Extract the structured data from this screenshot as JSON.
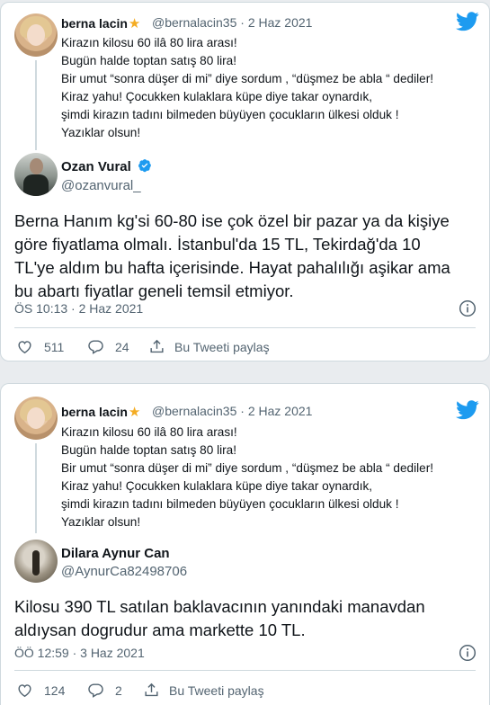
{
  "colors": {
    "twitter_blue": "#1d9bf0",
    "secondary_text": "#536471",
    "border": "#cfd9de",
    "star": "#f4ac23"
  },
  "tweets": [
    {
      "quoted": {
        "name": "berna lacin",
        "handle": "@bernalacin35",
        "sep": "·",
        "date": "2 Haz 2021",
        "lines": [
          "Kirazın kilosu 60 ilâ 80 lira arası!",
          "Bugün halde toptan satış 80 lira!",
          "Bir umut “sonra düşer di mi” diye sordum , “düşmez be abla “ dediler!",
          "Kiraz yahu! Çocukken kulaklara küpe diye takar oynardık,",
          "şimdi kirazın tadını bilmeden büyüyen çocukların ülkesi olduk !",
          "Yazıklar olsun!"
        ]
      },
      "reply": {
        "name": "Ozan Vural",
        "handle": "@ozanvural_",
        "verified": true,
        "lines": [
          "Berna Hanım kg'si 60-80 ise çok özel bir pazar ya da kişiye",
          "göre fiyatlama olmalı. İstanbul'da 15 TL, Tekirdağ'da 10",
          "TL'ye aldım bu hafta içerisinde. Hayat pahalılığı aşikar ama",
          "bu abartı fiyatlar geneli temsil etmiyor."
        ],
        "timestamp": "ÖS 10:13 · 2 Haz 2021",
        "likes": "511",
        "replies": "24",
        "share_label": "Bu Tweeti paylaş"
      }
    },
    {
      "quoted": {
        "name": "berna lacin",
        "handle": "@bernalacin35",
        "sep": "·",
        "date": "2 Haz 2021",
        "lines": [
          "Kirazın kilosu 60 ilâ 80 lira arası!",
          "Bugün halde toptan satış 80 lira!",
          "Bir umut “sonra düşer di mi” diye sordum , “düşmez be abla “ dediler!",
          "Kiraz yahu! Çocukken kulaklara küpe diye takar oynardık,",
          "şimdi kirazın tadını bilmeden büyüyen çocukların ülkesi olduk !",
          "Yazıklar olsun!"
        ]
      },
      "reply": {
        "name": "Dilara Aynur Can",
        "handle": "@AynurCa82498706",
        "verified": false,
        "lines": [
          "Kilosu 390 TL satılan baklavacının yanındaki manavdan",
          "aldıysan dogrudur ama markette 10 TL."
        ],
        "timestamp": "ÖÖ 12:59 · 3 Haz 2021",
        "likes": "124",
        "replies": "2",
        "share_label": "Bu Tweeti paylaş"
      }
    }
  ]
}
